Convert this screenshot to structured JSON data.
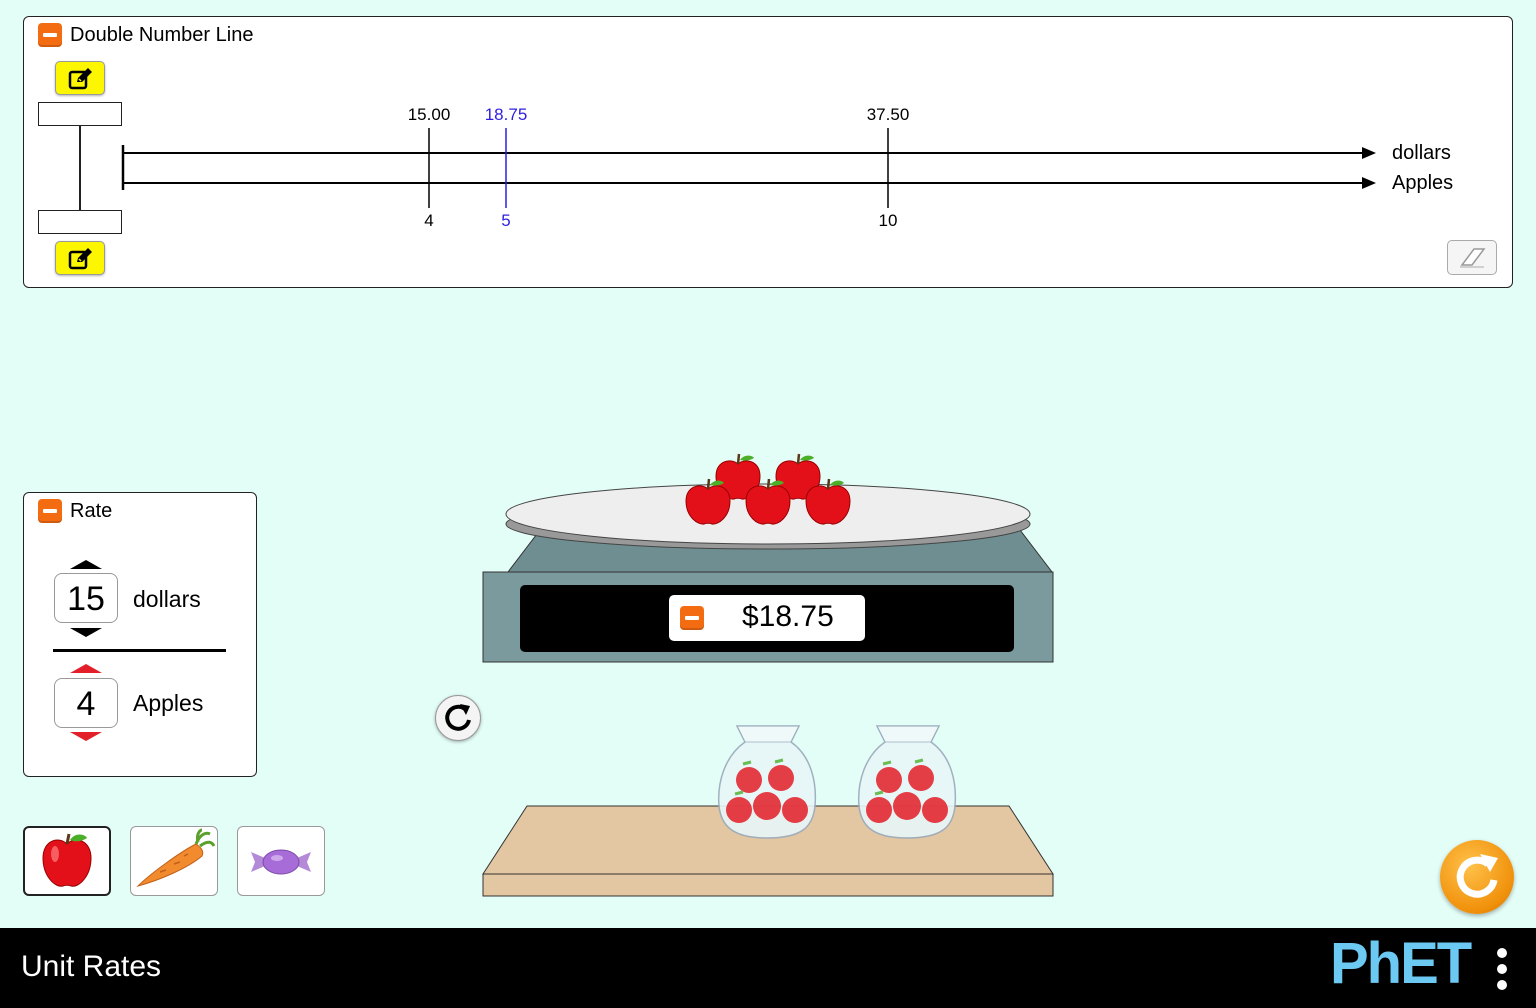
{
  "double_number_line": {
    "title": "Double Number Line",
    "top_axis_label": "dollars",
    "bottom_axis_label": "Apples",
    "top_ticks": [
      {
        "label": "15.00",
        "value": 15.0,
        "highlight": false
      },
      {
        "label": "18.75",
        "value": 18.75,
        "highlight": true
      },
      {
        "label": "37.50",
        "value": 37.5,
        "highlight": false
      }
    ],
    "bottom_ticks": [
      {
        "label": "4",
        "value": 4,
        "highlight": false
      },
      {
        "label": "5",
        "value": 5,
        "highlight": true
      },
      {
        "label": "10",
        "value": 10,
        "highlight": false
      }
    ],
    "highlight_color": "#2f1fe0"
  },
  "rate": {
    "title": "Rate",
    "numerator_value": "15",
    "numerator_unit": "dollars",
    "denominator_value": "4",
    "denominator_unit": "Apples"
  },
  "scale": {
    "readout": "$18.75",
    "apples_on_scale": 5
  },
  "shelf": {
    "bags": 2
  },
  "item_selector": [
    "apple",
    "carrot",
    "candy"
  ],
  "selected_item": "apple",
  "app": {
    "title": "Unit Rates",
    "brand": "PhET"
  },
  "colors": {
    "background": "#e3fdf7",
    "accent_orange": "#f36c12",
    "yellow_button": "#fcf600",
    "scale_body": "#7a9a9e",
    "shelf": "#e3c6a2"
  }
}
